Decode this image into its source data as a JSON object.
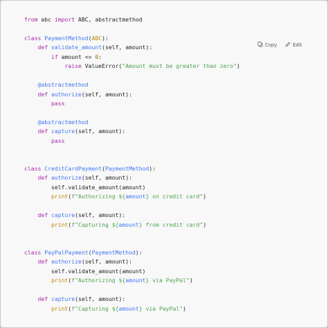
{
  "toolbar": {
    "copy_label": "Copy",
    "edit_label": "Edit",
    "copy_icon": "copy-icon",
    "edit_icon": "edit-icon"
  },
  "code_language": "python",
  "code_lines": [
    [
      [
        "kw",
        "from"
      ],
      [
        "plain",
        " abc "
      ],
      [
        "kw",
        "import"
      ],
      [
        "plain",
        " ABC, abstractmethod"
      ]
    ],
    [],
    [
      [
        "kw",
        "class"
      ],
      [
        "plain",
        " "
      ],
      [
        "fn",
        "PaymentMethod"
      ],
      [
        "plain",
        "("
      ],
      [
        "cls",
        "ABC"
      ],
      [
        "plain",
        "):"
      ]
    ],
    [
      [
        "plain",
        "    "
      ],
      [
        "kw",
        "def"
      ],
      [
        "plain",
        " "
      ],
      [
        "fn",
        "validate_amount"
      ],
      [
        "plain",
        "(self, amount):"
      ]
    ],
    [
      [
        "plain",
        "        "
      ],
      [
        "kw",
        "if"
      ],
      [
        "plain",
        " amount <= "
      ],
      [
        "num",
        "0"
      ],
      [
        "plain",
        ":"
      ]
    ],
    [
      [
        "plain",
        "            "
      ],
      [
        "kw",
        "raise"
      ],
      [
        "plain",
        " ValueError("
      ],
      [
        "str",
        "\"Amount must be greater than zero\""
      ],
      [
        "plain",
        ")"
      ]
    ],
    [],
    [
      [
        "plain",
        "    "
      ],
      [
        "dec",
        "@abstractmethod"
      ]
    ],
    [
      [
        "plain",
        "    "
      ],
      [
        "kw",
        "def"
      ],
      [
        "plain",
        " "
      ],
      [
        "fn",
        "authorize"
      ],
      [
        "plain",
        "(self, amount):"
      ]
    ],
    [
      [
        "plain",
        "        "
      ],
      [
        "kw",
        "pass"
      ]
    ],
    [],
    [
      [
        "plain",
        "    "
      ],
      [
        "dec",
        "@abstractmethod"
      ]
    ],
    [
      [
        "plain",
        "    "
      ],
      [
        "kw",
        "def"
      ],
      [
        "plain",
        " "
      ],
      [
        "fn",
        "capture"
      ],
      [
        "plain",
        "(self, amount):"
      ]
    ],
    [
      [
        "plain",
        "        "
      ],
      [
        "kw",
        "pass"
      ]
    ],
    [],
    [],
    [
      [
        "kw",
        "class"
      ],
      [
        "plain",
        " "
      ],
      [
        "fn",
        "CreditCardPayment"
      ],
      [
        "plain",
        "("
      ],
      [
        "fn",
        "PaymentMethod"
      ],
      [
        "plain",
        "):"
      ]
    ],
    [
      [
        "plain",
        "    "
      ],
      [
        "kw",
        "def"
      ],
      [
        "plain",
        " "
      ],
      [
        "fn",
        "authorize"
      ],
      [
        "plain",
        "(self, amount):"
      ]
    ],
    [
      [
        "plain",
        "        self.validate_amount(amount)"
      ]
    ],
    [
      [
        "plain",
        "        "
      ],
      [
        "bi",
        "print"
      ],
      [
        "plain",
        "("
      ],
      [
        "str",
        "f\"Authorizing ${"
      ],
      [
        "fn",
        "amount"
      ],
      [
        "str",
        "} on credit card\""
      ],
      [
        "plain",
        ")"
      ]
    ],
    [],
    [
      [
        "plain",
        "    "
      ],
      [
        "kw",
        "def"
      ],
      [
        "plain",
        " "
      ],
      [
        "fn",
        "capture"
      ],
      [
        "plain",
        "(self, amount):"
      ]
    ],
    [
      [
        "plain",
        "        "
      ],
      [
        "bi",
        "print"
      ],
      [
        "plain",
        "("
      ],
      [
        "str",
        "f\"Capturing ${"
      ],
      [
        "fn",
        "amount"
      ],
      [
        "str",
        "} from credit card\""
      ],
      [
        "plain",
        ")"
      ]
    ],
    [],
    [],
    [
      [
        "kw",
        "class"
      ],
      [
        "plain",
        " "
      ],
      [
        "fn",
        "PayPalPayment"
      ],
      [
        "plain",
        "("
      ],
      [
        "fn",
        "PaymentMethod"
      ],
      [
        "plain",
        "):"
      ]
    ],
    [
      [
        "plain",
        "    "
      ],
      [
        "kw",
        "def"
      ],
      [
        "plain",
        " "
      ],
      [
        "fn",
        "authorize"
      ],
      [
        "plain",
        "(self, amount):"
      ]
    ],
    [
      [
        "plain",
        "        self.validate_amount(amount)"
      ]
    ],
    [
      [
        "plain",
        "        "
      ],
      [
        "bi",
        "print"
      ],
      [
        "plain",
        "("
      ],
      [
        "str",
        "f\"Authorizing ${"
      ],
      [
        "fn",
        "amount"
      ],
      [
        "str",
        "} via PayPal\""
      ],
      [
        "plain",
        ")"
      ]
    ],
    [],
    [
      [
        "plain",
        "    "
      ],
      [
        "kw",
        "def"
      ],
      [
        "plain",
        " "
      ],
      [
        "fn",
        "capture"
      ],
      [
        "plain",
        "(self, amount):"
      ]
    ],
    [
      [
        "plain",
        "        "
      ],
      [
        "bi",
        "print"
      ],
      [
        "plain",
        "("
      ],
      [
        "str",
        "f\"Capturing ${"
      ],
      [
        "fn",
        "amount"
      ],
      [
        "str",
        "} via PayPal\""
      ],
      [
        "plain",
        ")"
      ]
    ]
  ]
}
